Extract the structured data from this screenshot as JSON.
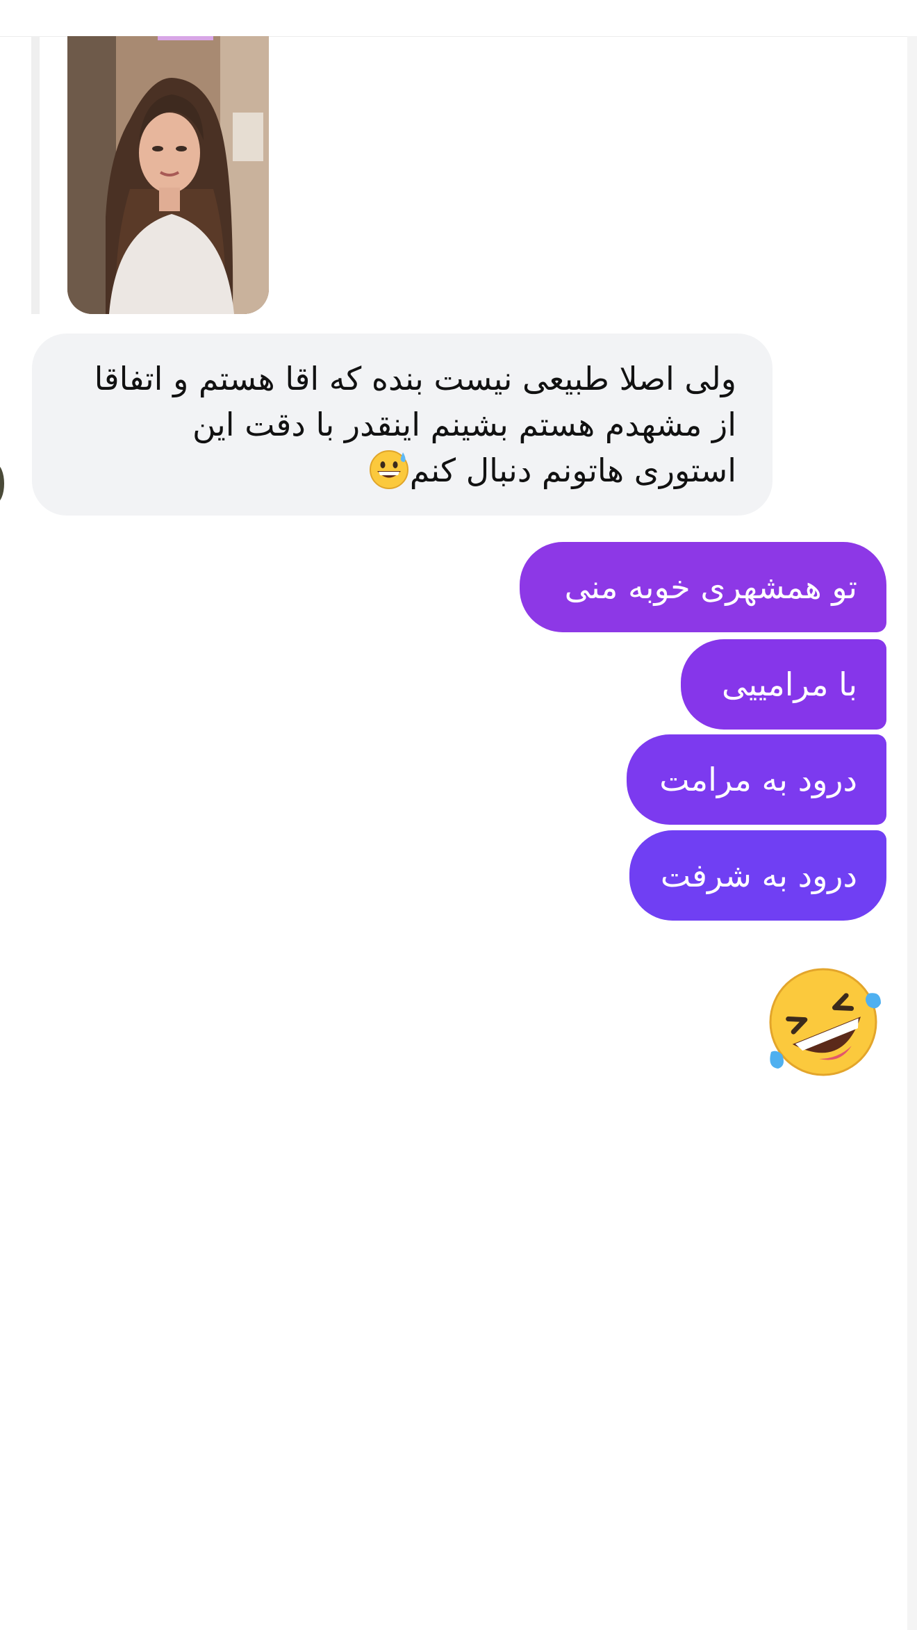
{
  "story_reply": {
    "image_alt": "story-image"
  },
  "incoming_message": {
    "lines": [
      "ولی اصلا طبیعی نیست بنده که اقا هستم و اتفاقا",
      "از مشهدم هستم بشینم اینقدر با دقت این",
      "استوری هاتونم دنبال کنم"
    ],
    "emoji": "grinning-face-with-sweat"
  },
  "outgoing_messages": [
    "تو همشهری خوبه منی",
    "با مرامییی",
    "درود به مرامت",
    "درود به شرفت"
  ],
  "big_emoji": "rolling-on-the-floor-laughing",
  "colors": {
    "incoming_bubble": "#f2f3f5",
    "outgoing_top": "#8d38e6",
    "outgoing_bottom": "#703ff3",
    "background": "#ffffff"
  }
}
